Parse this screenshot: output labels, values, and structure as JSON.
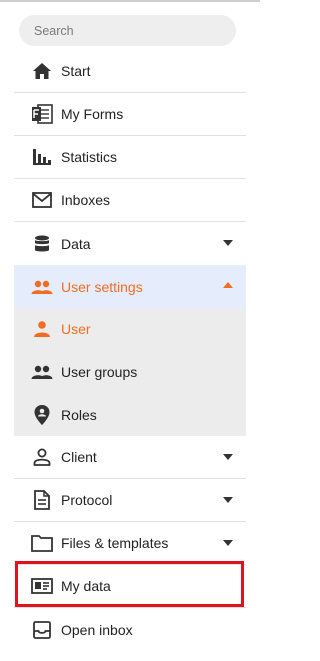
{
  "search": {
    "placeholder": "Search"
  },
  "menu": {
    "start": "Start",
    "my_forms": "My Forms",
    "statistics": "Statistics",
    "inboxes": "Inboxes",
    "data": "Data",
    "user_settings": "User settings",
    "user": "User",
    "user_groups": "User groups",
    "roles": "Roles",
    "client": "Client",
    "protocol": "Protocol",
    "files_templates": "Files & templates",
    "my_data": "My data",
    "open_inbox": "Open inbox"
  },
  "colors": {
    "accent": "#f26d21",
    "active_bg": "#e5ecfb",
    "submenu_bg": "#ececec",
    "highlight": "#e0121e"
  }
}
